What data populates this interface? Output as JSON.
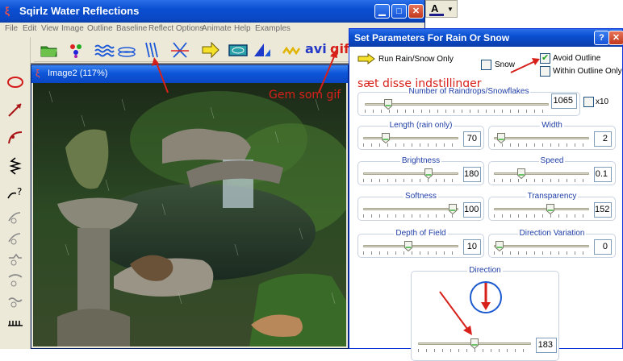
{
  "main_window": {
    "title": "Sqirlz Water Reflections",
    "menu": [
      "File",
      "Edit",
      "View",
      "Image",
      "Outline",
      "Baseline",
      "Reflect Options",
      "Animate",
      "Help",
      "Examples"
    ],
    "toolbar_text": {
      "avi": "avi",
      "gif": "gif"
    }
  },
  "image_window": {
    "title": "Image2  (117%)"
  },
  "annotations": {
    "settings_note": "sæt disse indstillinger",
    "save_note": "Gem som gif"
  },
  "dialog": {
    "title": "Set Parameters For Rain Or Snow",
    "help_label": "?",
    "close_label": "✕",
    "run_label": "Run Rain/Snow Only",
    "snow_label": "Snow",
    "avoid_outline_label": "Avoid Outline",
    "within_outline_label": "Within Outline Only",
    "x10_label": "x10",
    "checks": {
      "snow": false,
      "avoid_outline": true,
      "within_outline": false,
      "x10": false
    },
    "sliders": {
      "raindrops": {
        "label": "Number of Raindrops/Snowflakes",
        "value": "1065",
        "fraction": 0.11
      },
      "length": {
        "label": "Length (rain only)",
        "value": "70",
        "fraction": 0.21
      },
      "width": {
        "label": "Width",
        "value": "2",
        "fraction": 0.04
      },
      "brightness": {
        "label": "Brightness",
        "value": "180",
        "fraction": 0.7
      },
      "speed": {
        "label": "Speed",
        "value": "0.1",
        "fraction": 0.27
      },
      "softness": {
        "label": "Softness",
        "value": "100",
        "fraction": 0.98
      },
      "transparency": {
        "label": "Transparency",
        "value": "152",
        "fraction": 0.6
      },
      "depth_of_field": {
        "label": "Depth of Field",
        "value": "10",
        "fraction": 0.47
      },
      "direction_variation": {
        "label": "Direction Variation",
        "value": "0",
        "fraction": 0.02
      },
      "direction": {
        "label": "Direction",
        "value": "183",
        "fraction": 0.5
      }
    }
  },
  "colors": {
    "title_blue": "#0a4fd0",
    "annotation_red": "#d8201a",
    "group_label": "#1f3ea6"
  }
}
